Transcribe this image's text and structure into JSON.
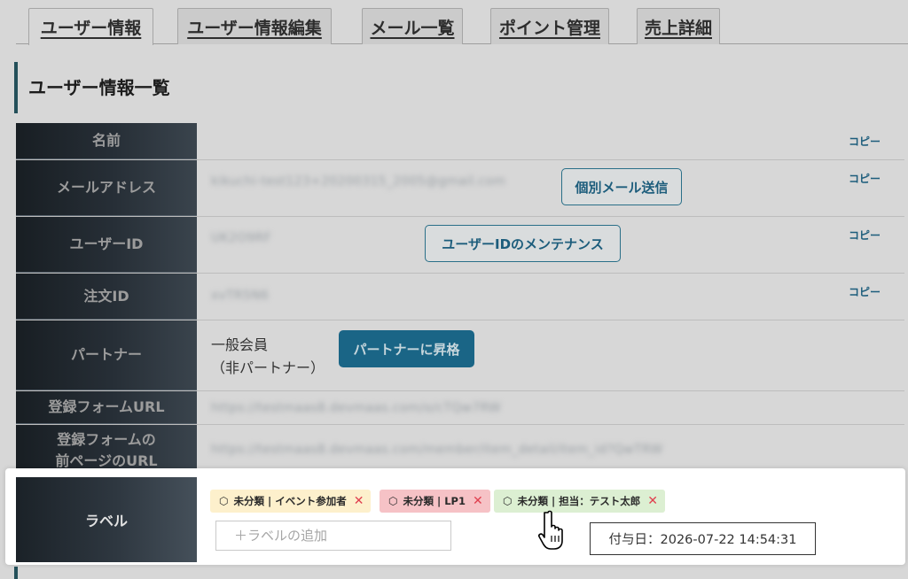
{
  "tabs": [
    {
      "label": "ユーザー情報",
      "active": true
    },
    {
      "label": "ユーザー情報編集",
      "active": false
    },
    {
      "label": "メール一覧",
      "active": false
    },
    {
      "label": "ポイント管理",
      "active": false
    },
    {
      "label": "売上詳細",
      "active": false
    }
  ],
  "section_title": "ユーザー情報一覧",
  "copy_label": "コピー",
  "rows": {
    "name": {
      "header": "名前",
      "value": ""
    },
    "email": {
      "header": "メールアドレス",
      "value": "kikuchi-test123+20200315_2005@gmail.com",
      "button": "個別メール送信"
    },
    "user_id": {
      "header": "ユーザーID",
      "value": "UK2O9RF",
      "button": "ユーザーIDのメンテナンス"
    },
    "order_id": {
      "header": "注文ID",
      "value": "xvTR5N6"
    },
    "partner": {
      "header": "パートナー",
      "status_line1": "一般会員",
      "status_line2": "（非パートナー）",
      "button": "パートナーに昇格"
    },
    "form_url": {
      "header": "登録フォームURL",
      "value": "https://testmaas8.devmaas.com/o/cTQw7RW"
    },
    "prev_url": {
      "header": "登録フォームの\n前ページのURL",
      "value": "https://testmaas8.devmaas.com/member/item_detail/item_id?QwTRW"
    },
    "label": {
      "header": "ラベル",
      "chips": [
        {
          "text": "未分類 | イベント参加者",
          "bg": "#fdf0cc"
        },
        {
          "text": "未分類 | LP1",
          "bg": "#f6c2c6"
        },
        {
          "text": "未分類 | 担当：テスト太郎",
          "bg": "#dcefd2"
        }
      ],
      "input_placeholder": "＋ラベルの追加",
      "tooltip": "付与日：2026-07-22 14:54:31"
    }
  },
  "colors": {
    "accent": "#1a6586",
    "header_dark": "#1b2228",
    "close": "#e0404f"
  }
}
